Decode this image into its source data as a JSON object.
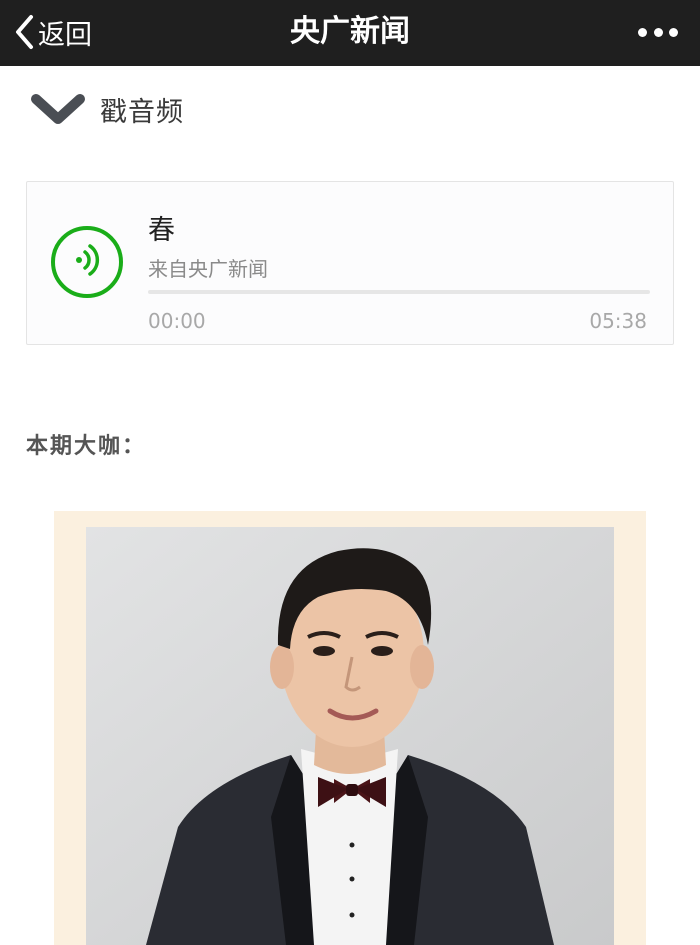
{
  "navbar": {
    "back_label": "返回",
    "title": "央广新闻",
    "back_icon": "chevron-left-icon",
    "more_icon": "more-dots-icon"
  },
  "collapse": {
    "label": "戳音频",
    "icon": "chevron-down-icon"
  },
  "audio": {
    "title": "春",
    "source": "来自央广新闻",
    "current_time": "00:00",
    "total_time": "05:38",
    "progress": 0,
    "play_icon": "audio-wave-icon",
    "accent_color": "#1aad19"
  },
  "section": {
    "heading": "本期大咖："
  },
  "portrait": {
    "frame_color": "#fbf0df",
    "photo_background": "#d8d8d8"
  }
}
